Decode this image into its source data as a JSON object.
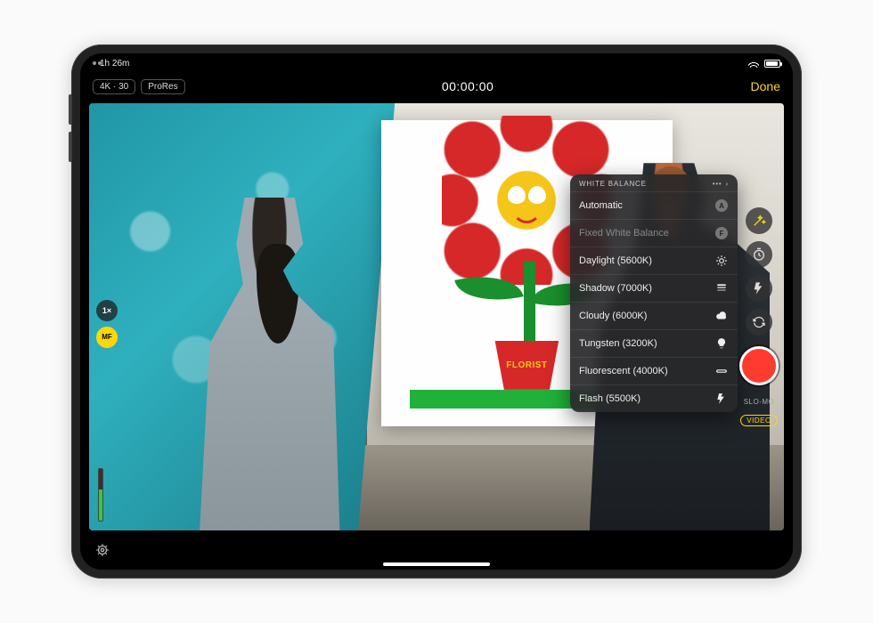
{
  "status": {
    "time": "1h 26m"
  },
  "topbar": {
    "resolution": "4K · 30",
    "codec": "ProRes",
    "timecode": "00:00:00",
    "done": "Done"
  },
  "left_controls": {
    "zoom": "1×",
    "focus_mode": "MF"
  },
  "white_balance": {
    "title": "WHITE BALANCE",
    "items": [
      {
        "label": "Automatic",
        "badge": "A",
        "icon": ""
      },
      {
        "label": "Fixed White Balance",
        "badge": "F",
        "icon": "",
        "dim": true
      },
      {
        "label": "Daylight (5600K)",
        "badge": "",
        "icon": "sun"
      },
      {
        "label": "Shadow (7000K)",
        "badge": "",
        "icon": "shade"
      },
      {
        "label": "Cloudy (6000K)",
        "badge": "",
        "icon": "cloud"
      },
      {
        "label": "Tungsten (3200K)",
        "badge": "",
        "icon": "bulb"
      },
      {
        "label": "Fluorescent (4000K)",
        "badge": "",
        "icon": "tube"
      },
      {
        "label": "Flash (5500K)",
        "badge": "",
        "icon": "bolt"
      }
    ]
  },
  "tools": [
    {
      "name": "wand-icon",
      "glyph": "wand",
      "active": true
    },
    {
      "name": "timer-icon",
      "glyph": "timer",
      "active": false
    },
    {
      "name": "flash-icon",
      "glyph": "bolt",
      "active": false
    },
    {
      "name": "flip-icon",
      "glyph": "flip",
      "active": false
    }
  ],
  "modes": {
    "above": "SLO-MO",
    "selected": "VIDEO"
  },
  "poster": {
    "pot_text": "FLORIST"
  }
}
